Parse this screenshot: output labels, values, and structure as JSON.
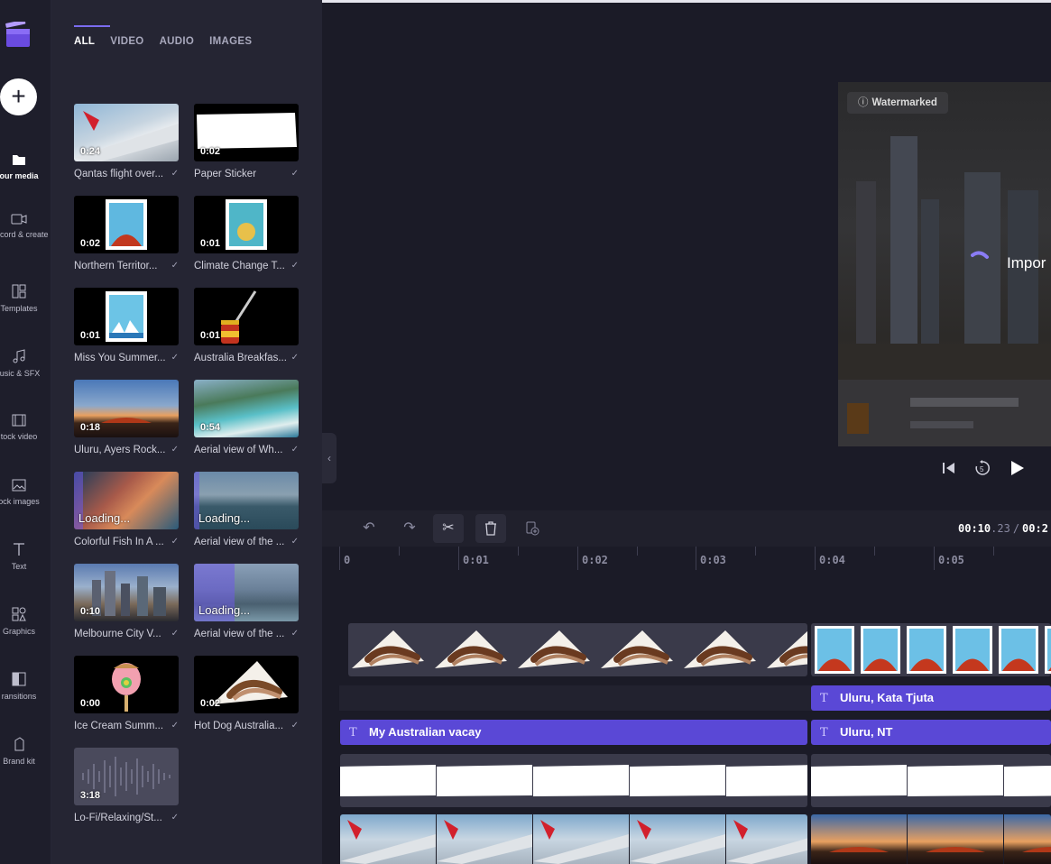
{
  "sidebar": {
    "add_label": "+",
    "items": [
      {
        "label": "our media",
        "icon": "folder-icon"
      },
      {
        "label": "Record & create",
        "icon": "camera-icon"
      },
      {
        "label": "Templates",
        "icon": "templates-icon"
      },
      {
        "label": "lusic & SFX",
        "icon": "music-note-icon"
      },
      {
        "label": "tock video",
        "icon": "film-icon"
      },
      {
        "label": "ock images",
        "icon": "image-icon"
      },
      {
        "label": "Text",
        "icon": "text-icon"
      },
      {
        "label": "Graphics",
        "icon": "shapes-icon"
      },
      {
        "label": "ransitions",
        "icon": "transitions-icon"
      },
      {
        "label": "Brand kit",
        "icon": "brand-kit-icon"
      }
    ]
  },
  "media": {
    "tabs": [
      "ALL",
      "VIDEO",
      "AUDIO",
      "IMAGES"
    ],
    "items": [
      {
        "title": "Qantas flight over...",
        "duration": "0:24",
        "loading": ""
      },
      {
        "title": "Paper Sticker",
        "duration": "0:02",
        "loading": ""
      },
      {
        "title": "Northern Territor...",
        "duration": "0:02",
        "loading": ""
      },
      {
        "title": "Climate Change T...",
        "duration": "0:01",
        "loading": ""
      },
      {
        "title": "Miss You Summer...",
        "duration": "0:01",
        "loading": ""
      },
      {
        "title": "Australia Breakfas...",
        "duration": "0:01",
        "loading": ""
      },
      {
        "title": "Uluru, Ayers Rock...",
        "duration": "0:18",
        "loading": ""
      },
      {
        "title": "Aerial view of Wh...",
        "duration": "0:54",
        "loading": ""
      },
      {
        "title": "Colorful Fish In A ...",
        "duration": "",
        "loading": "Loading..."
      },
      {
        "title": "Aerial view of the ...",
        "duration": "",
        "loading": "Loading..."
      },
      {
        "title": "Melbourne City V...",
        "duration": "0:10",
        "loading": ""
      },
      {
        "title": "Aerial view of the ...",
        "duration": "",
        "loading": "Loading..."
      },
      {
        "title": "Ice Cream Summ...",
        "duration": "0:00",
        "loading": ""
      },
      {
        "title": "Hot Dog Australia...",
        "duration": "0:02",
        "loading": ""
      },
      {
        "title": "Lo-Fi/Relaxing/St...",
        "duration": "3:18",
        "loading": ""
      }
    ],
    "check": "✓"
  },
  "preview": {
    "watermark": "Watermarked",
    "import_text": "Impor"
  },
  "timeline": {
    "timecode_current": "00:10",
    "timecode_frames": ".23",
    "timecode_sep": "/",
    "timecode_total": "00:2",
    "ruler_labels": [
      "0",
      "0:01",
      "0:02",
      "0:03",
      "0:04",
      "0:05"
    ],
    "text_clips": [
      {
        "label": "Uluru, Kata Tjuta"
      },
      {
        "label": "My Australian vacay"
      },
      {
        "label": "Uluru, NT"
      }
    ]
  }
}
